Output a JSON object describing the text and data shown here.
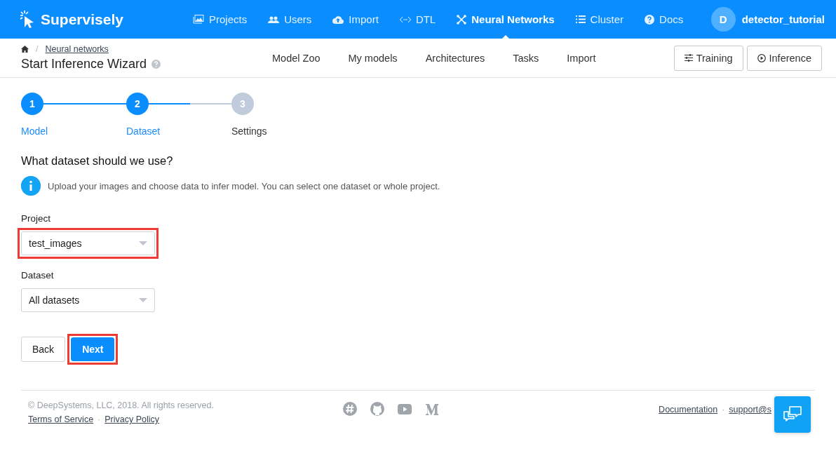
{
  "header": {
    "logo": "Supervisely",
    "nav": [
      {
        "label": "Projects",
        "selected": false
      },
      {
        "label": "Users",
        "selected": false
      },
      {
        "label": "Import",
        "selected": false
      },
      {
        "label": "DTL",
        "selected": false
      },
      {
        "label": "Neural Networks",
        "selected": true
      },
      {
        "label": "Cluster",
        "selected": false
      },
      {
        "label": "Docs",
        "selected": false
      }
    ],
    "user": {
      "initial": "D",
      "name": "detector_tutorial"
    }
  },
  "subheader": {
    "breadcrumb_separator": "/",
    "breadcrumb": "Neural networks",
    "title": "Start Inference Wizard",
    "tabs": [
      "Model Zoo",
      "My models",
      "Architectures",
      "Tasks",
      "Import"
    ],
    "buttons": [
      "Training",
      "Inference"
    ]
  },
  "steps": [
    {
      "number": "1",
      "label": "Model",
      "reached": true
    },
    {
      "number": "2",
      "label": "Dataset",
      "reached": true
    },
    {
      "number": "3",
      "label": "Settings",
      "reached": false
    }
  ],
  "question": "What dataset should we use?",
  "info": "Upload your images and choose data to infer model. You can select one dataset or whole project.",
  "fields": [
    {
      "label": "Project",
      "value": "test_images",
      "highlighted": true
    },
    {
      "label": "Dataset",
      "value": "All datasets",
      "highlighted": false
    }
  ],
  "actions": [
    {
      "label": "Back",
      "kind": "secondary",
      "highlighted": false
    },
    {
      "label": "Next",
      "kind": "primary",
      "highlighted": true
    }
  ],
  "footer": {
    "copyright": "© DeepSystems, LLC, 2018. All rights reserved.",
    "links": [
      "Terms of Service",
      "Privacy Policy"
    ],
    "links_separator": "·",
    "right_links": [
      "Documentation",
      "support@s"
    ],
    "right_separator": "·"
  }
}
